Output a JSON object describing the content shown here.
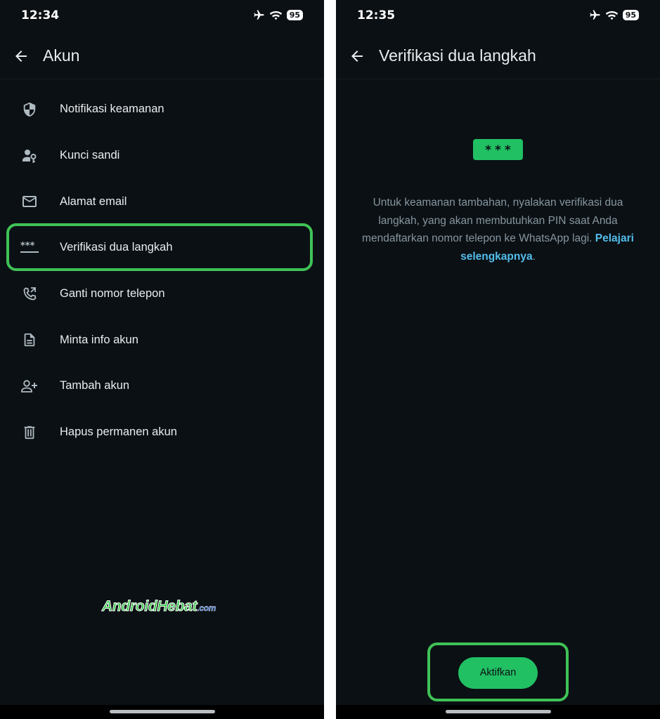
{
  "left_screen": {
    "status": {
      "time": "12:34",
      "battery": "95"
    },
    "title": "Akun",
    "menu": [
      {
        "label": "Notifikasi keamanan",
        "icon": "shield-icon"
      },
      {
        "label": "Kunci sandi",
        "icon": "passkey-icon"
      },
      {
        "label": "Alamat email",
        "icon": "email-icon"
      },
      {
        "label": "Verifikasi dua langkah",
        "icon": "two-step-icon"
      },
      {
        "label": "Ganti nomor telepon",
        "icon": "phone-change-icon"
      },
      {
        "label": "Minta info akun",
        "icon": "document-icon"
      },
      {
        "label": "Tambah akun",
        "icon": "add-person-icon"
      },
      {
        "label": "Hapus permanen akun",
        "icon": "trash-icon"
      }
    ],
    "watermark": {
      "main": "AndroidHebat",
      "domain": ".com"
    }
  },
  "right_screen": {
    "status": {
      "time": "12:35",
      "battery": "95"
    },
    "title": "Verifikasi dua langkah",
    "pin_badge": "***",
    "description": "Untuk keamanan tambahan, nyalakan verifikasi dua langkah, yang akan membutuhkan PIN saat Anda mendaftarkan nomor telepon ke WhatsApp lagi.",
    "learn_more": "Pelajari selengkapnya",
    "description_end": ".",
    "button": "Aktifkan"
  },
  "colors": {
    "background": "#0b1014",
    "accent": "#21c063",
    "highlight": "#3fc256",
    "link": "#53bdeb",
    "secondary_text": "#8696a0"
  }
}
